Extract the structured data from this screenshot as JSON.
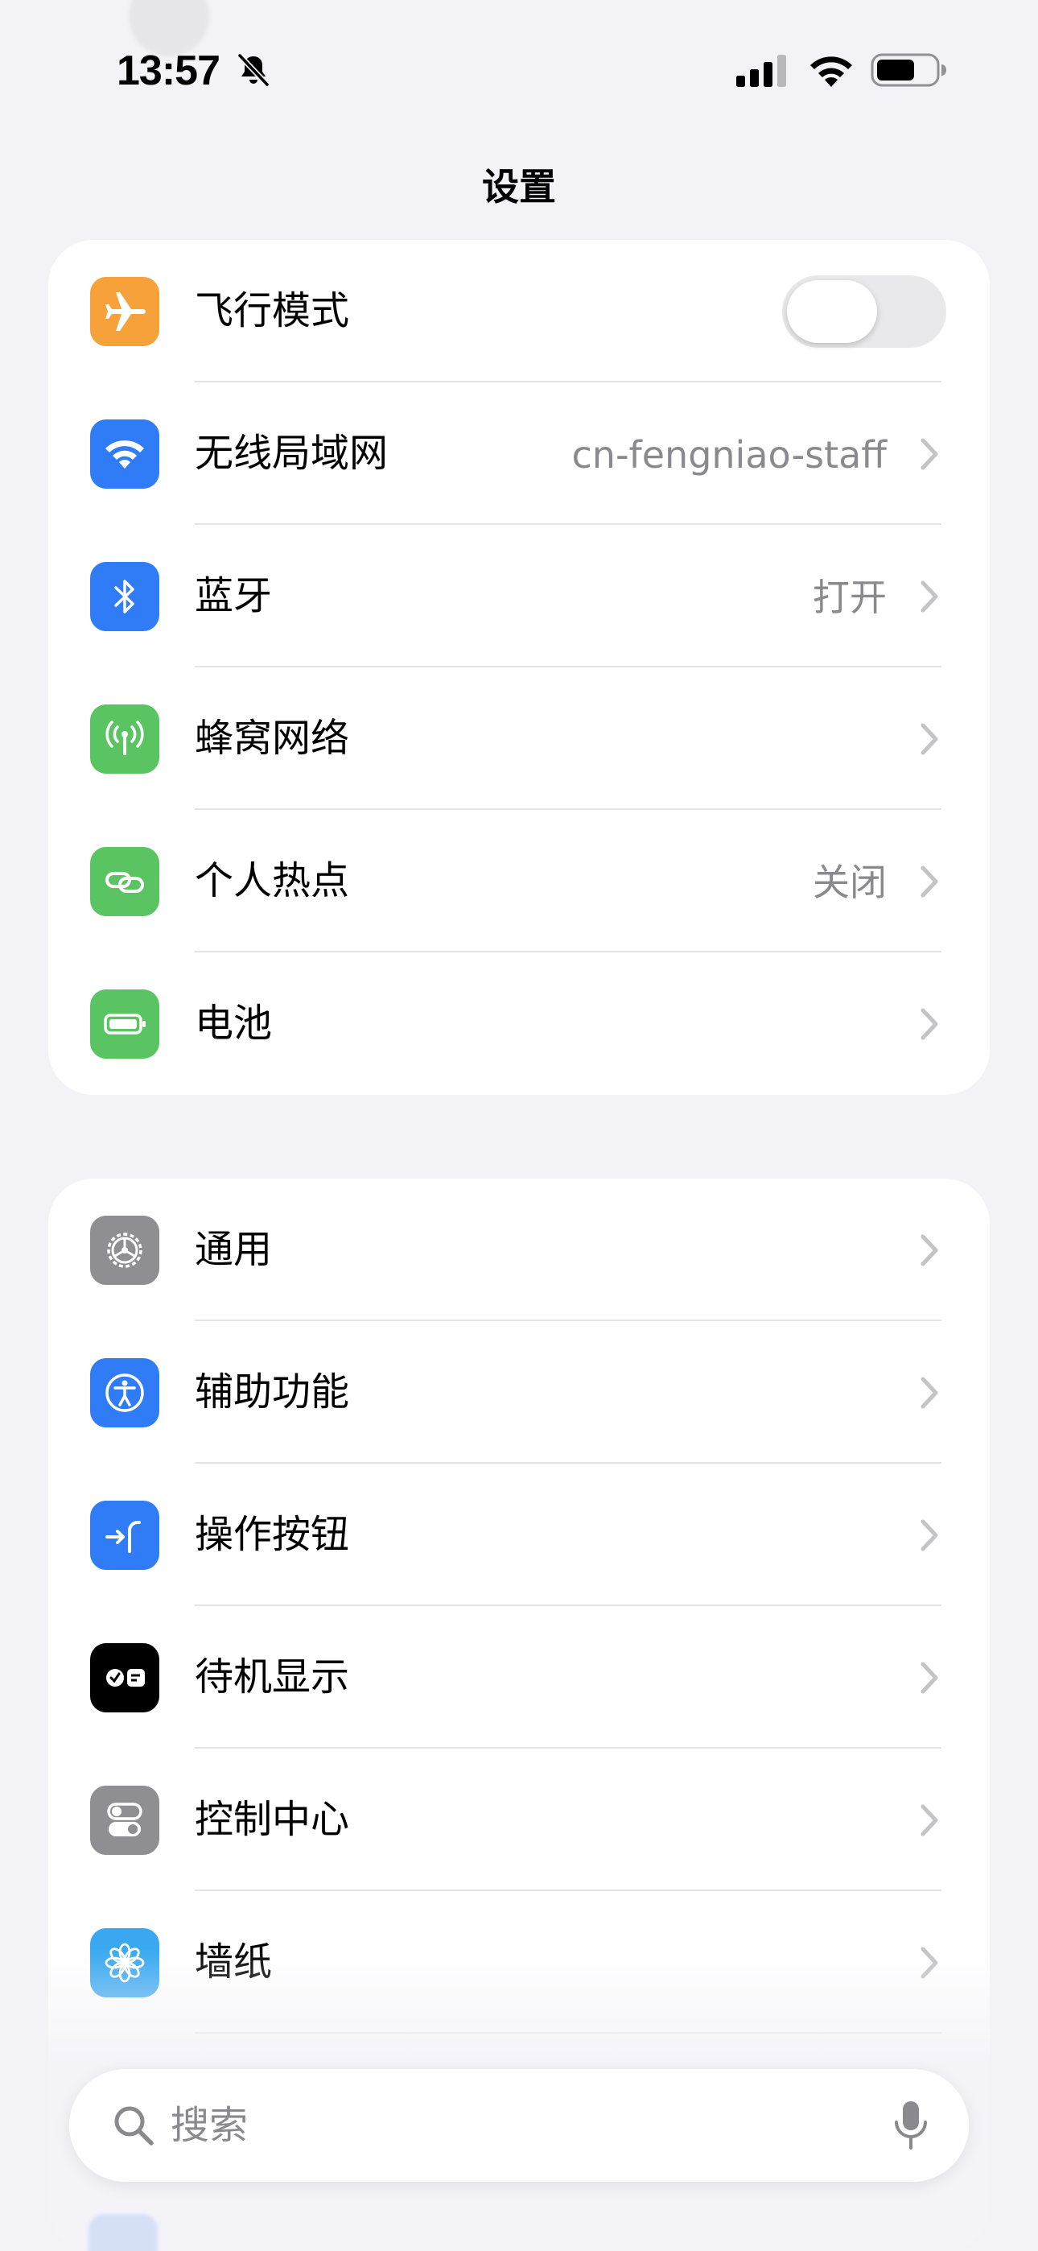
{
  "status_bar": {
    "time": "13:57"
  },
  "header": {
    "title": "设置"
  },
  "section_network": [
    {
      "label": "飞行模式",
      "value": "",
      "icon": "airplane-icon",
      "color": "#f7a13a",
      "control": "toggle",
      "toggle_on": false
    },
    {
      "label": "无线局域网",
      "value": "cn-fengniao-staff",
      "icon": "wifi-icon",
      "color": "#2f7cf6",
      "control": "chevron"
    },
    {
      "label": "蓝牙",
      "value": "打开",
      "icon": "bluetooth-icon",
      "color": "#2f7cf6",
      "control": "chevron"
    },
    {
      "label": "蜂窝网络",
      "value": "",
      "icon": "antenna-icon",
      "color": "#5ac463",
      "control": "chevron"
    },
    {
      "label": "个人热点",
      "value": "关闭",
      "icon": "link-icon",
      "color": "#5ac463",
      "control": "chevron"
    },
    {
      "label": "电池",
      "value": "",
      "icon": "battery-icon",
      "color": "#5ac463",
      "control": "chevron"
    }
  ],
  "section_general": [
    {
      "label": "通用",
      "value": "",
      "icon": "gear-icon",
      "color": "#8e8e93",
      "control": "chevron"
    },
    {
      "label": "辅助功能",
      "value": "",
      "icon": "accessibility-icon",
      "color": "#2f7cf6",
      "control": "chevron"
    },
    {
      "label": "操作按钮",
      "value": "",
      "icon": "action-button-icon",
      "color": "#2f7cf6",
      "control": "chevron"
    },
    {
      "label": "待机显示",
      "value": "",
      "icon": "standby-icon",
      "color": "#000000",
      "control": "chevron"
    },
    {
      "label": "控制中心",
      "value": "",
      "icon": "toggles-icon",
      "color": "#8e8e93",
      "control": "chevron"
    },
    {
      "label": "墙纸",
      "value": "",
      "icon": "flower-icon",
      "color": "#39a8f0",
      "control": "chevron"
    }
  ],
  "search": {
    "placeholder": "搜索"
  }
}
